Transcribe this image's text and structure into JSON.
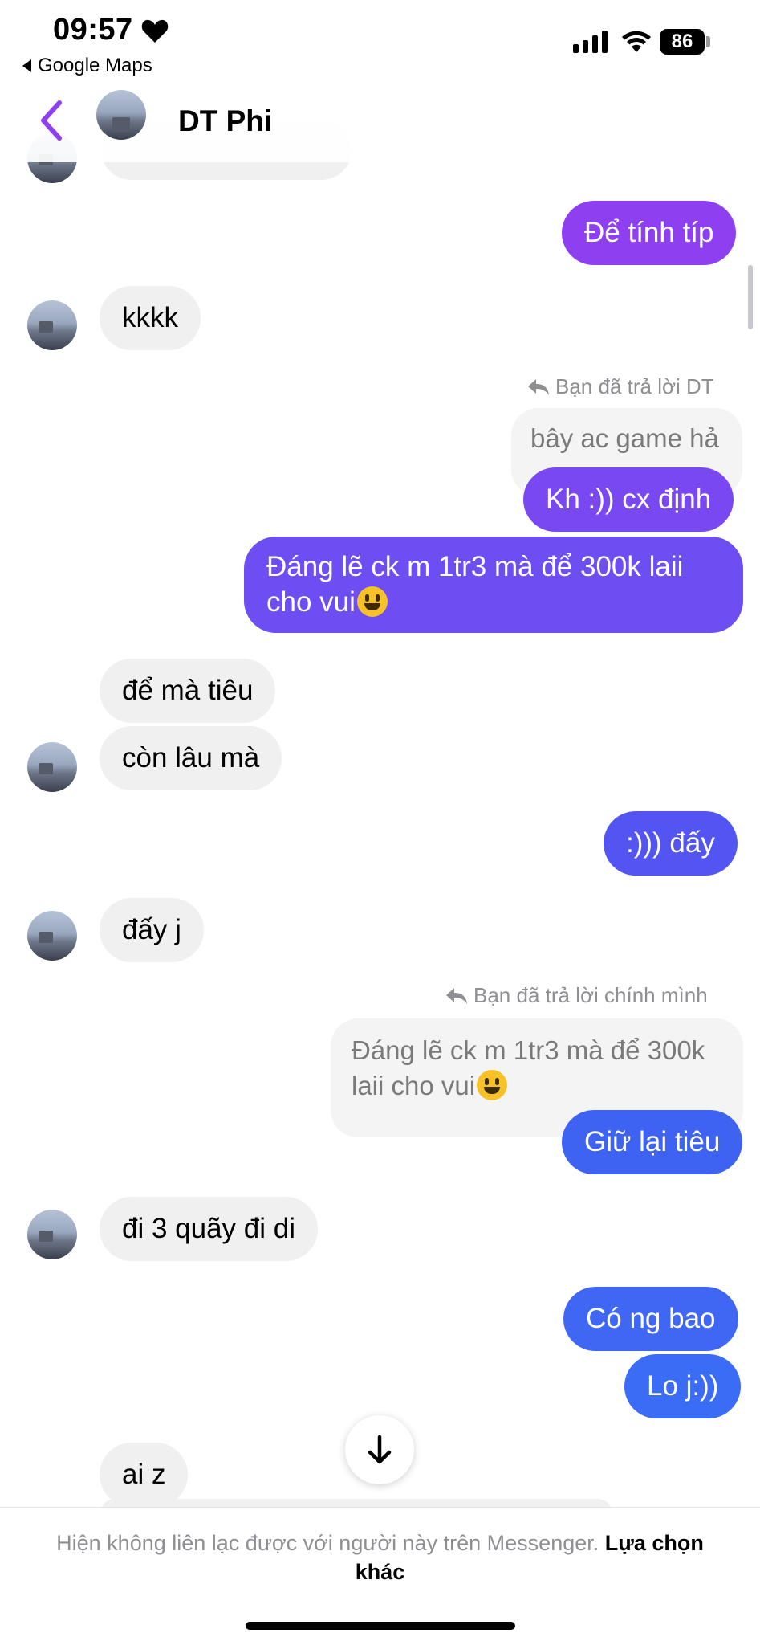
{
  "status_bar": {
    "time": "09:57",
    "back_app": "Google Maps",
    "battery": "86",
    "icons": [
      "heart-icon",
      "signal-icon",
      "wifi-icon",
      "battery-icon"
    ]
  },
  "header": {
    "contact_name": "DT Phi",
    "back_icon": "chevron-left-icon"
  },
  "messages": {
    "m1": "Để tính típ",
    "m2": "kkkk",
    "reply1_note": "Bạn đã trả lời DT",
    "reply1_quote": "bây ac game hả",
    "m3": "Kh :)) cx định",
    "m4_line1": "Đáng lẽ ck m 1tr3 mà để 300k laii",
    "m4_line2": "cho vui",
    "m5": "để mà tiêu",
    "m6": "còn lâu mà",
    "m7": ":))) đấy",
    "m8": "đấy j",
    "reply2_note": "Bạn đã trả lời chính mình",
    "reply2_quote_line1": "Đáng lẽ ck m 1tr3 mà để 300k",
    "reply2_quote_line2": "laii cho vui",
    "m9": "Giữ lại tiêu",
    "m10": "đi 3 quãy đi di",
    "m11": "Có ng bao",
    "m12": "Lo j:))",
    "m13": "ai z"
  },
  "footer": {
    "notice": "Hiện không liên lạc được với người này trên Messenger.",
    "link": "Lựa chọn khác"
  },
  "colors": {
    "accent_purple": "#8e3ff0",
    "bubble_violet": "#6e4df2",
    "bubble_blue": "#3e63f2",
    "incoming": "#f0f0f0"
  }
}
